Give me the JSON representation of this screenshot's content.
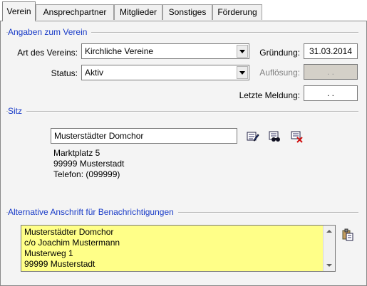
{
  "tabs": [
    {
      "label": "Verein",
      "active": true
    },
    {
      "label": "Ansprechpartner",
      "active": false
    },
    {
      "label": "Mitglieder",
      "active": false
    },
    {
      "label": "Sonstiges",
      "active": false
    },
    {
      "label": "Förderung",
      "active": false
    }
  ],
  "verein": {
    "section_title": "Angaben zum Verein",
    "art_label": "Art des Vereins:",
    "art_value": "Kirchliche Vereine",
    "status_label": "Status:",
    "status_value": "Aktiv",
    "gruendung_label": "Gründung:",
    "gruendung_value": "31.03.2014",
    "aufloesung_label": "Auflösung:",
    "aufloesung_value": " .  .",
    "meldung_label": "Letzte Meldung:",
    "meldung_value": " .  ."
  },
  "sitz": {
    "section_title": "Sitz",
    "name_value": "Musterstädter Domchor",
    "address_lines": [
      "Marktplatz 5",
      "99999 Musterstadt",
      "Telefon: (099999)"
    ],
    "icons": [
      "edit-address-icon",
      "search-address-icon",
      "delete-address-icon"
    ]
  },
  "alternativ": {
    "section_title": "Alternative Anschrift für Benachrichtigungen",
    "lines": [
      "Musterstädter Domchor",
      "c/o Joachim Mustermann",
      "Musterweg 1",
      "99999 Musterstadt"
    ],
    "icon": "paste-address-icon",
    "memo_color": "#ffff88"
  },
  "colors": {
    "section_title": "#1a3cc8",
    "panel_bg": "#f4f4f4"
  }
}
